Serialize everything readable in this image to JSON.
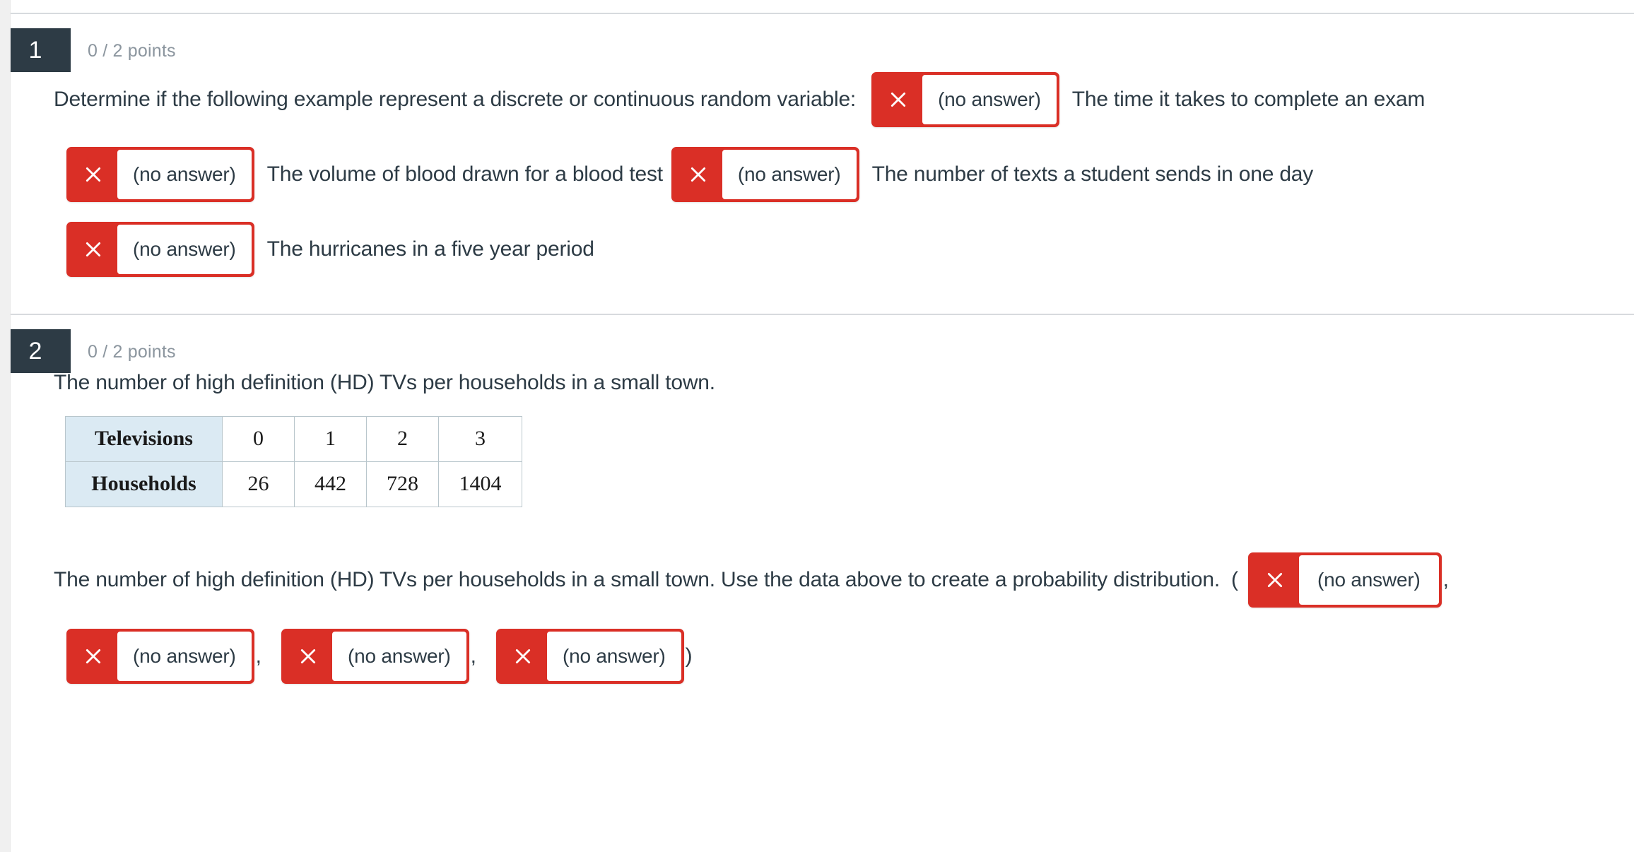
{
  "icons": {
    "wrong_mark": "x-mark-icon"
  },
  "colors": {
    "wrong_red": "#da2f26",
    "badge_dark": "#2d3b45",
    "points_grey": "#8b959e",
    "table_header_blue": "#dbeaf3"
  },
  "no_answer_label": "(no answer)",
  "questions": [
    {
      "number": "1",
      "points": "0 / 2 points",
      "prompt": "Determine if the following example represent a discrete or continuous random variable:",
      "items": [
        {
          "answer": "(no answer)",
          "label": "The time it takes to complete an exam"
        },
        {
          "answer": "(no answer)",
          "label": "The volume of blood drawn for a blood test"
        },
        {
          "answer": "(no answer)",
          "label": "The number of texts a student sends in one day"
        },
        {
          "answer": "(no answer)",
          "label": "The hurricanes in a five year period"
        }
      ]
    },
    {
      "number": "2",
      "points": "0 / 2 points",
      "intro": "The number of high definition (HD) TVs per households in a small town.",
      "table": {
        "row_headers": [
          "Televisions",
          "Households"
        ],
        "televisions": [
          "0",
          "1",
          "2",
          "3"
        ],
        "households": [
          "26",
          "442",
          "728",
          "1404"
        ]
      },
      "prompt": "The number of high definition (HD) TVs per households in a small town. Use the data above to create a probability distribution.",
      "open_paren": "(",
      "close_paren": ")",
      "comma": ",",
      "answers": [
        "(no answer)",
        "(no answer)",
        "(no answer)",
        "(no answer)"
      ]
    }
  ]
}
